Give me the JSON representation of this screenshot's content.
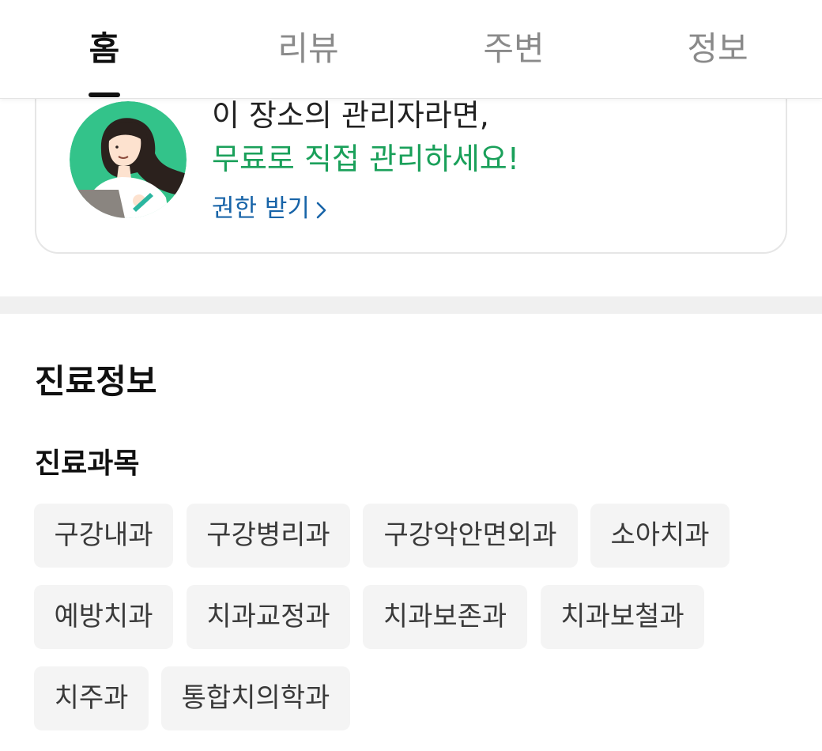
{
  "tabs": [
    {
      "label": "홈",
      "active": true
    },
    {
      "label": "리뷰",
      "active": false
    },
    {
      "label": "주변",
      "active": false
    },
    {
      "label": "정보",
      "active": false
    }
  ],
  "claim_card": {
    "line1": "이 장소의 관리자라면,",
    "line2": "무료로 직접 관리하세요!",
    "link_label": "권한 받기",
    "avatar_icon": "woman-with-laptop-illustration",
    "accent_color": "#1aa05a",
    "link_color": "#1864a8"
  },
  "medical_info": {
    "title": "진료정보",
    "subjects_title": "진료과목",
    "subjects": [
      "구강내과",
      "구강병리과",
      "구강악안면외과",
      "소아치과",
      "예방치과",
      "치과교정과",
      "치과보존과",
      "치과보철과",
      "치주과",
      "통합치의학과"
    ]
  }
}
